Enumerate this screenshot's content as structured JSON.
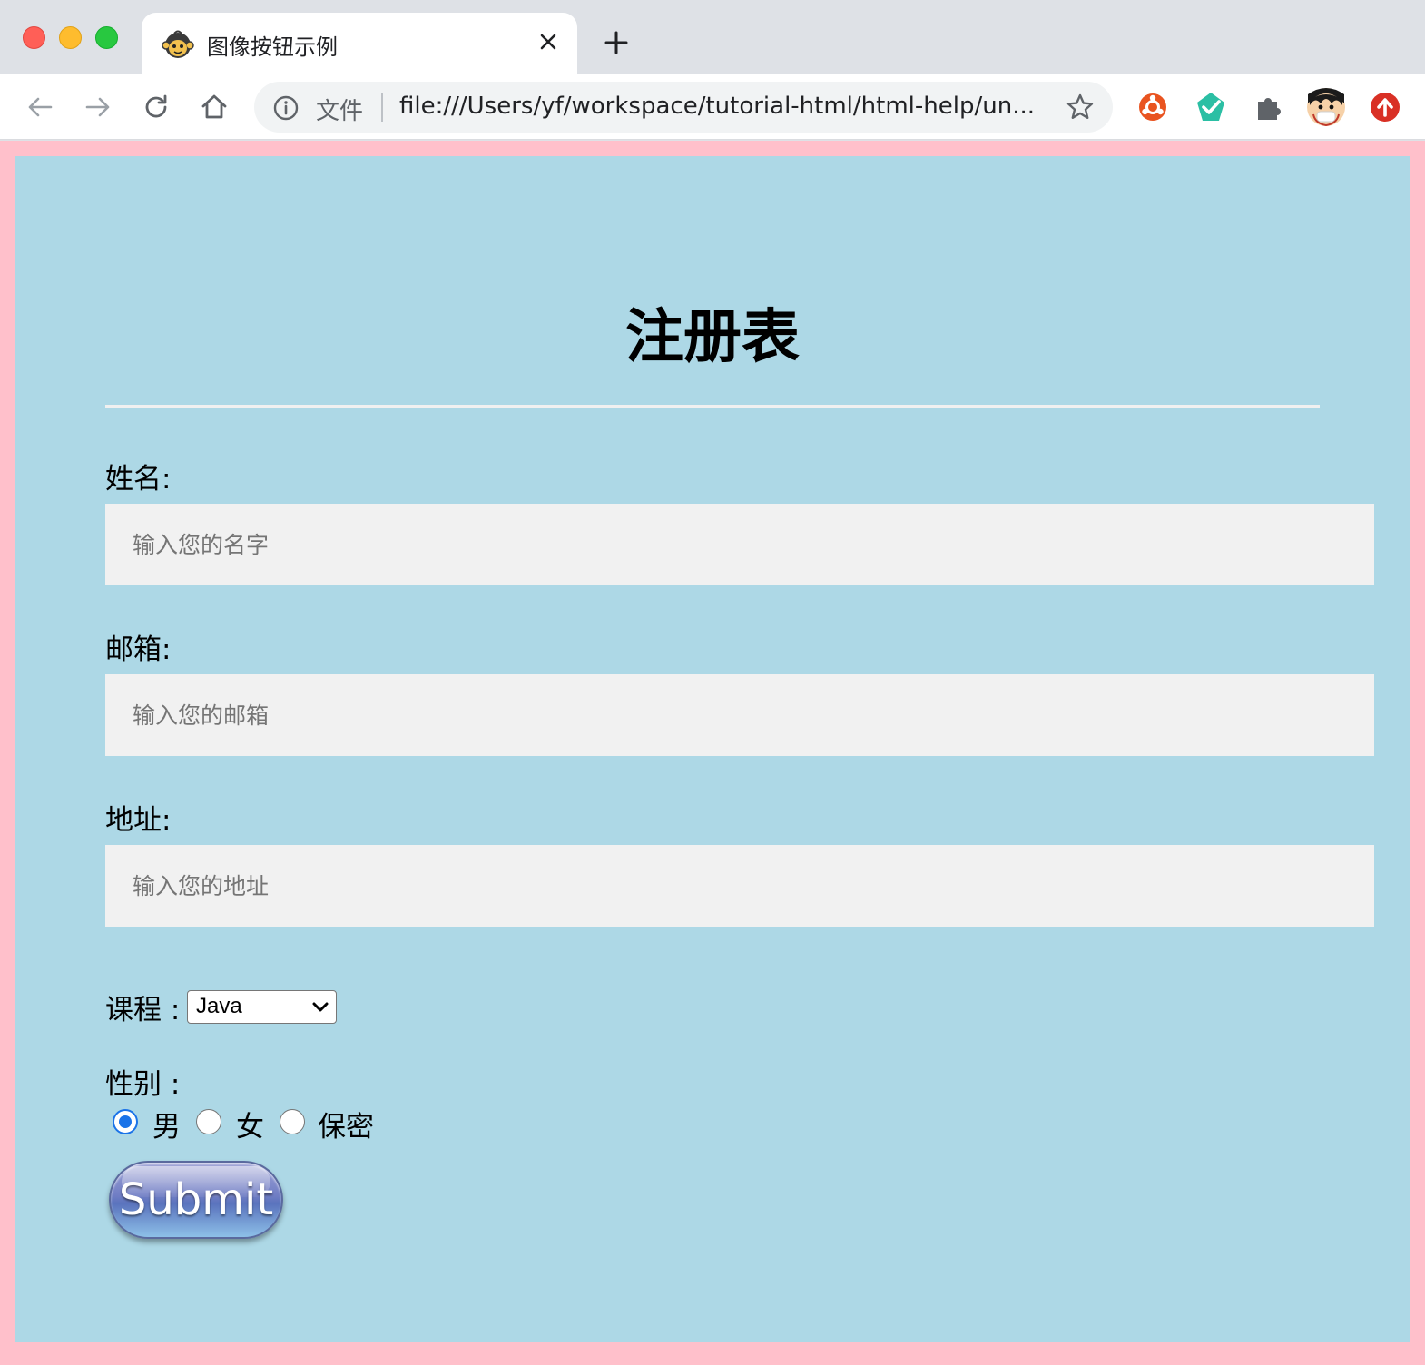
{
  "browser": {
    "tab_title": "图像按钮示例",
    "new_tab_symbol": "+",
    "address_scheme_label": "文件",
    "address_url": "file:///Users/yf/workspace/tutorial-html/html-help/un...",
    "extension_icons": [
      "ubuntu-extension-icon",
      "checkmark-extension-icon",
      "puzzle-extensions-icon",
      "profile-avatar",
      "update-icon"
    ]
  },
  "page": {
    "title": "注册表",
    "name_field": {
      "label": "姓名:",
      "placeholder": "输入您的名字",
      "value": ""
    },
    "email_field": {
      "label": "邮箱:",
      "placeholder": "输入您的邮箱",
      "value": ""
    },
    "address_field": {
      "label": "地址:",
      "placeholder": "输入您的地址",
      "value": ""
    },
    "course": {
      "label": "课程 :",
      "selected": "Java"
    },
    "gender": {
      "label": "性别 :",
      "options": [
        {
          "label": "男",
          "checked": true
        },
        {
          "label": "女",
          "checked": false
        },
        {
          "label": "保密",
          "checked": false
        }
      ]
    },
    "submit_label": "Submit"
  },
  "colors": {
    "page_background": "#ffc0cb",
    "form_background": "#add8e6",
    "input_background": "#f1f1f1",
    "radio_accent": "#1a73e8"
  }
}
